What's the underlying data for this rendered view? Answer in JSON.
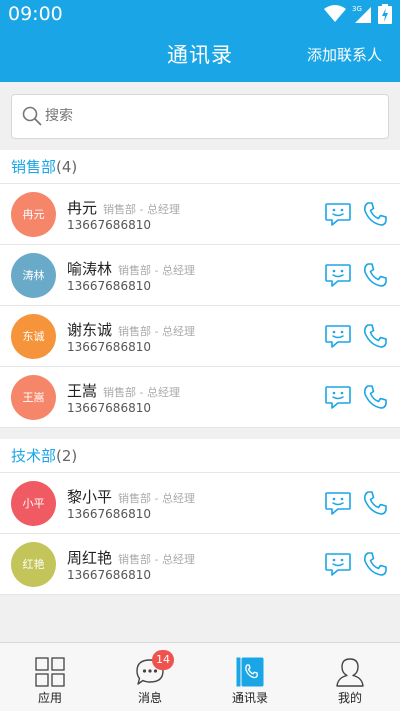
{
  "status_bar": {
    "time": "09:00",
    "network": "3G"
  },
  "header": {
    "title": "通讯录",
    "action": "添加联系人"
  },
  "search": {
    "placeholder": "搜索"
  },
  "colors": {
    "accent": "#1aa6e6",
    "badge": "#f0524e"
  },
  "sections": [
    {
      "name": "销售部",
      "count": "(4)",
      "contacts": [
        {
          "avatar_text": "冉元",
          "name": "冉元",
          "title": "销售部 - 总经理",
          "phone": "13667686810",
          "color": "#f5866a"
        },
        {
          "avatar_text": "涛林",
          "name": "喻涛林",
          "title": "销售部 - 总经理",
          "phone": "13667686810",
          "color": "#6aaac9"
        },
        {
          "avatar_text": "东诚",
          "name": "谢东诚",
          "title": "销售部 - 总经理",
          "phone": "13667686810",
          "color": "#f5943a"
        },
        {
          "avatar_text": "王嵩",
          "name": "王嵩",
          "title": "销售部 - 总经理",
          "phone": "13667686810",
          "color": "#f5866a"
        }
      ]
    },
    {
      "name": "技术部",
      "count": "(2)",
      "contacts": [
        {
          "avatar_text": "小平",
          "name": "黎小平",
          "title": "销售部 - 总经理",
          "phone": "13667686810",
          "color": "#f05a62"
        },
        {
          "avatar_text": "红艳",
          "name": "周红艳",
          "title": "销售部 - 总经理",
          "phone": "13667686810",
          "color": "#c3c45a"
        }
      ]
    }
  ],
  "tabs": [
    {
      "label": "应用",
      "icon": "apps-grid-icon"
    },
    {
      "label": "消息",
      "icon": "chat-bubble-icon",
      "badge": "14"
    },
    {
      "label": "通讯录",
      "icon": "contacts-book-icon",
      "active": true
    },
    {
      "label": "我的",
      "icon": "profile-icon"
    }
  ]
}
